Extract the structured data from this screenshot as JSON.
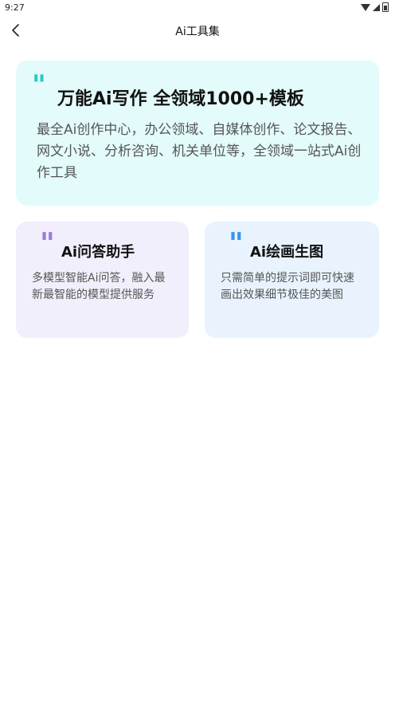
{
  "status_bar": {
    "time": "9:27"
  },
  "header": {
    "title": "Ai工具集"
  },
  "cards": {
    "main": {
      "title": "万能Ai写作 全领域1000+模板",
      "description": "最全Ai创作中心，办公领域、自媒体创作、论文报告、网文小说、分析咨询、机关单位等，全领域一站式Ai创作工具"
    },
    "qa": {
      "title": "Ai问答助手",
      "description": "多模型智能Ai问答，融入最新最智能的模型提供服务"
    },
    "draw": {
      "title": "Ai绘画生图",
      "description": "只需简单的提示词即可快速画出效果细节极佳的美图"
    }
  },
  "colors": {
    "main_card_bg": "#e3fbfa",
    "qa_card_bg": "#f1effb",
    "draw_card_bg": "#e8f3fd",
    "main_quote": "#28c9c5",
    "qa_quote": "#9a7be0",
    "draw_quote": "#3a93ea"
  },
  "icons": {
    "back": "chevron-left-icon",
    "quote": "quote-mark-icon"
  }
}
